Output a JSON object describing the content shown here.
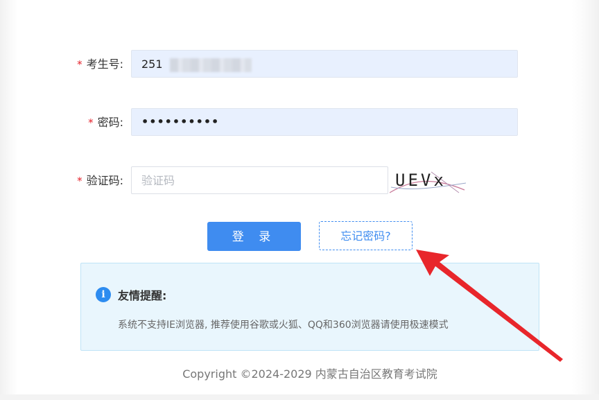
{
  "form": {
    "exam_number": {
      "required_mark": "*",
      "label": "考生号:",
      "value": "251"
    },
    "password": {
      "required_mark": "*",
      "label": "密码:",
      "value": "••••••••••"
    },
    "captcha": {
      "required_mark": "*",
      "label": "验证码:",
      "placeholder": "验证码",
      "image_text": "UEVx"
    }
  },
  "buttons": {
    "login": "登 录",
    "forgot_password": "忘记密码?"
  },
  "notice": {
    "icon": "info-icon",
    "icon_glyph": "i",
    "title": "友情提醒:",
    "text": "系统不支持IE浏览器, 推荐使用谷歌或火狐、QQ和360浏览器请使用极速模式"
  },
  "footer": {
    "copyright": "Copyright ©2024-2029 内蒙古自治区教育考试院"
  },
  "colors": {
    "primary": "#3f8cf0",
    "required": "#e5222b",
    "annotation_arrow": "#e8262b",
    "notice_bg": "#e9f6fd"
  }
}
